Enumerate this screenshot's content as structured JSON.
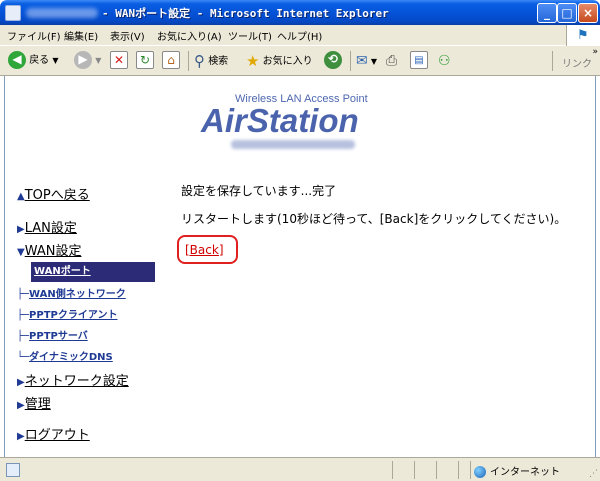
{
  "window": {
    "title": "- WANポート設定 - Microsoft Internet Explorer",
    "min_label": "_",
    "max_label": "□",
    "close_label": "×"
  },
  "menu": [
    "ファイル(F)",
    "編集(E)",
    "表示(V)",
    "お気に入り(A)",
    "ツール(T)",
    "ヘルプ(H)"
  ],
  "toolbar": {
    "back_label": "戻る",
    "search_label": "検索",
    "favorites_label": "お気に入り",
    "links_label": "リンク"
  },
  "logo": {
    "subtitle": "Wireless LAN Access Point",
    "name": "AirStation"
  },
  "nav": {
    "top": "TOPへ戻る",
    "lan": "LAN設定",
    "wan": "WAN設定",
    "wan_items": [
      "WANポート",
      "WAN側ネットワーク",
      "PPTPクライアント",
      "PPTPサーバ",
      "ダイナミックDNS"
    ],
    "network": "ネットワーク設定",
    "admin": "管理",
    "logout": "ログアウト"
  },
  "main": {
    "saving_message": "設定を保存しています...完了",
    "restart_message": "リスタートします(10秒ほど待って、[Back]をクリックしてください)。",
    "back_label": "[Back]"
  },
  "status": {
    "zone": "インターネット"
  },
  "colors": {
    "title_bar": "#0553d8",
    "logo": "#4a63ac",
    "nav_active": "#2c2b78",
    "back_highlight": "#e01f1f"
  }
}
